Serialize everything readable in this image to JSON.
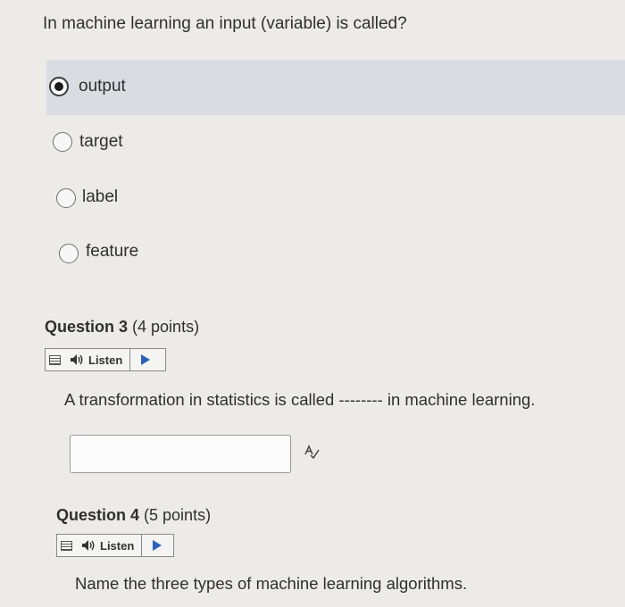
{
  "question2": {
    "prompt": "In machine learning an input (variable) is called?",
    "options": [
      {
        "label": "output",
        "selected": true
      },
      {
        "label": "target",
        "selected": false
      },
      {
        "label": "label",
        "selected": false
      },
      {
        "label": "feature",
        "selected": false
      }
    ]
  },
  "question3": {
    "title": "Question 3",
    "points": "(4 points)",
    "listen_label": "Listen",
    "prompt": "A transformation in statistics is called -------- in machine learning.",
    "answer_value": ""
  },
  "question4": {
    "title": "Question 4",
    "points": "(5 points)",
    "listen_label": "Listen",
    "prompt": "Name the three types of machine learning algorithms."
  },
  "icons": {
    "radio": "radio-button",
    "speaker": "speaker-icon",
    "play": "play-icon",
    "menu": "menu-icon",
    "spellcheck": "spellcheck-icon"
  },
  "colors": {
    "selected_row_bg": "#d9dde1",
    "play_blue": "#2a62b8"
  }
}
